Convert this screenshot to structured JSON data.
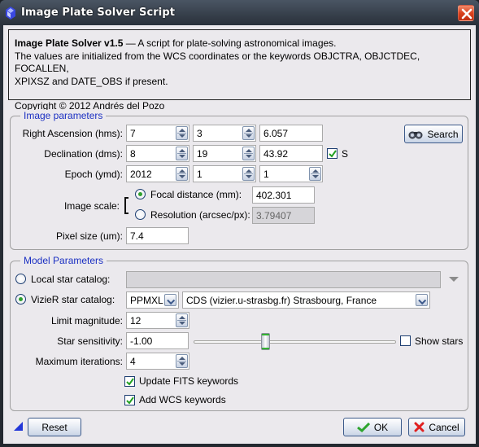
{
  "window": {
    "title": "Image Plate Solver Script",
    "close_icon": "close-x-icon"
  },
  "info": {
    "heading": "Image Plate Solver v1.5",
    "heading_rest": " — A script for plate-solving astronomical images.",
    "line2": "The values are initialized from the WCS coordinates or the keywords OBJCTRA, OBJCTDEC, FOCALLEN,",
    "line3": "XPIXSZ and DATE_OBS if present.",
    "copyright": "Copyright © 2012 Andrés del Pozo"
  },
  "image_params": {
    "title": "Image parameters",
    "ra": {
      "label": "Right Ascension (hms):",
      "h": "7",
      "m": "3",
      "s": "6.057"
    },
    "dec": {
      "label": "Declination (dms):",
      "d": "8",
      "m": "19",
      "s": "43.92",
      "south_label": "S",
      "south_checked": true
    },
    "epoch": {
      "label": "Epoch (ymd):",
      "y": "2012",
      "m": "1",
      "d": "1"
    },
    "search_button": "Search",
    "search_icon": "binoculars-icon",
    "scale": {
      "label": "Image scale:",
      "focal_label": "Focal distance (mm):",
      "focal_value": "402.301",
      "focal_selected": true,
      "resolution_label": "Resolution (arcsec/px):",
      "resolution_value": "3.79407",
      "resolution_selected": false
    },
    "pixel_size": {
      "label": "Pixel size (um):",
      "value": "7.4"
    }
  },
  "model_params": {
    "title": "Model Parameters",
    "local_catalog": {
      "label": "Local star catalog:",
      "selected": false,
      "value": ""
    },
    "vizier_catalog": {
      "label": "VizieR star catalog:",
      "selected": true,
      "catalog": "PPMXL",
      "server": "CDS (vizier.u-strasbg.fr) Strasbourg, France"
    },
    "limit_magnitude": {
      "label": "Limit magnitude:",
      "value": "12"
    },
    "star_sensitivity": {
      "label": "Star sensitivity:",
      "value": "-1.00",
      "slider_fraction": 0.35
    },
    "show_stars": {
      "label": "Show stars",
      "checked": false
    },
    "max_iterations": {
      "label": "Maximum iterations:",
      "value": "4"
    },
    "update_fits": {
      "label": "Update FITS keywords",
      "checked": true
    },
    "add_wcs": {
      "label": "Add WCS keywords",
      "checked": true
    }
  },
  "footer": {
    "reset": "Reset",
    "ok": "OK",
    "cancel": "Cancel"
  }
}
